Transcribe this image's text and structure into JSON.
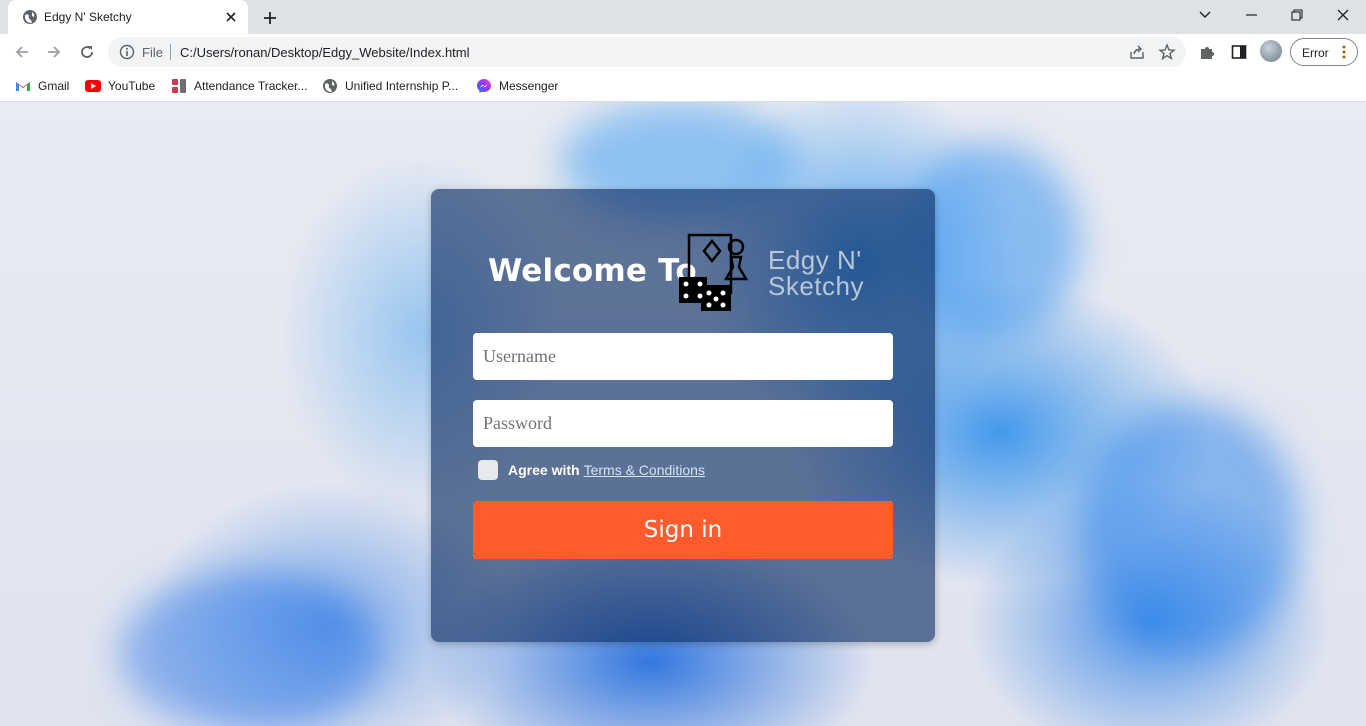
{
  "browser": {
    "tab_title": "Edgy N' Sketchy",
    "url_scheme": "File",
    "url": "C:/Users/ronan/Desktop/Edgy_Website/Index.html",
    "profile_status": "Error"
  },
  "bookmarks": [
    {
      "label": "Gmail",
      "icon": "gmail-icon"
    },
    {
      "label": "YouTube",
      "icon": "youtube-icon"
    },
    {
      "label": "Attendance Tracker...",
      "icon": "attendance-icon"
    },
    {
      "label": "Unified Internship P...",
      "icon": "globe-icon"
    },
    {
      "label": "Messenger",
      "icon": "messenger-icon"
    }
  ],
  "login": {
    "welcome": "Welcome To",
    "logo_line1": "Edgy N'",
    "logo_line2": "Sketchy",
    "username_placeholder": "Username",
    "password_placeholder": "Password",
    "agree_text": "Agree with",
    "terms_link": "Terms & Conditions",
    "signin_label": "Sign in"
  },
  "colors": {
    "accent": "#ff5b2d",
    "card": "#08285f",
    "ink_blue": "#2a8cea"
  }
}
